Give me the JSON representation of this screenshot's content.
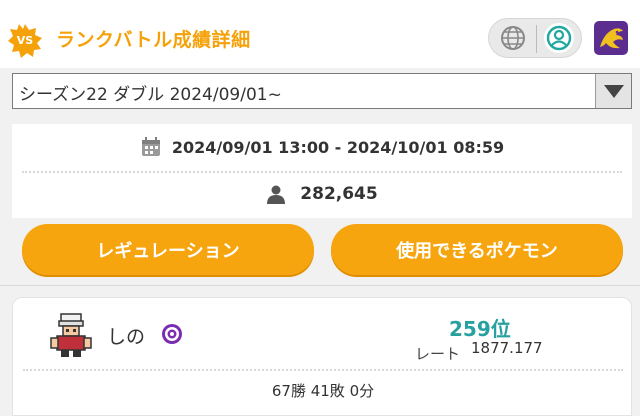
{
  "header": {
    "badge_text": "VS",
    "title": "ランクバトル成績詳細",
    "icons": [
      "globe-icon",
      "user-circle-icon",
      "trainer-avatar"
    ],
    "accent_color": "#f5a20a"
  },
  "season_select": {
    "selected": "シーズン22 ダブル 2024/09/01~"
  },
  "info": {
    "period": "2024/09/01 13:00 - 2024/10/01 08:59",
    "participants": "282,645"
  },
  "buttons": {
    "regulation": "レギュレーション",
    "usable_pokemon": "使用できるポケモン",
    "color": "#f7a50f"
  },
  "player": {
    "name": "しの",
    "rank": "259位",
    "rate_label": "レート",
    "rate_value": "1877.177",
    "record": "67勝 41敗 0分",
    "rank_color": "#27a0a0"
  }
}
